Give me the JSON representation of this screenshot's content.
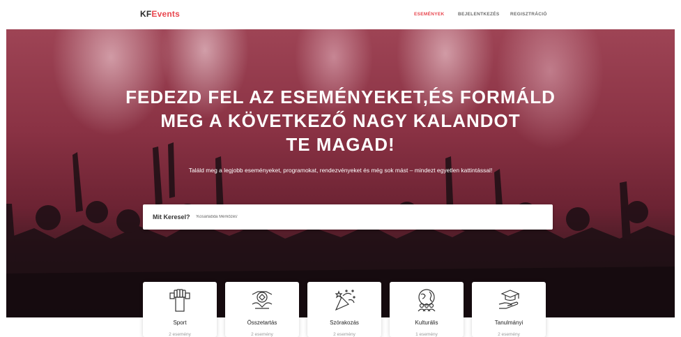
{
  "brand": {
    "part1": "KF",
    "part2": "Events"
  },
  "nav": {
    "events": "ESEMÉNYEK",
    "login": "BEJELENTKEZÉS",
    "register": "REGISZTRÁCIÓ"
  },
  "hero": {
    "title_line1": "FEDEZD FEL AZ ESEMÉNYEKET,ÉS FORMÁLD",
    "title_line2": "MEG A KÖVETKEZŐ NAGY KALANDOT",
    "title_line3": "TE MAGAD!",
    "subtitle": "Találd meg a legjobb eseményeket, programokat, rendezvényeket és még sok mást – mindezt egyetlen kattintással!"
  },
  "search": {
    "label": "Mit Keresel?",
    "placeholder": "'Kosárlabda Mérkőzés'"
  },
  "categories": [
    {
      "name": "Sport",
      "count": "2 esemény",
      "icon": "fist-icon"
    },
    {
      "name": "Összetartás",
      "count": "2 esemény",
      "icon": "teamwork-icon"
    },
    {
      "name": "Szórakozás",
      "count": "2 esemény",
      "icon": "party-popper-icon"
    },
    {
      "name": "Kulturális",
      "count": "1 esemény",
      "icon": "globe-people-icon"
    },
    {
      "name": "Tanulmányi",
      "count": "2 esemény",
      "icon": "graduation-cap-hand-icon"
    }
  ]
}
